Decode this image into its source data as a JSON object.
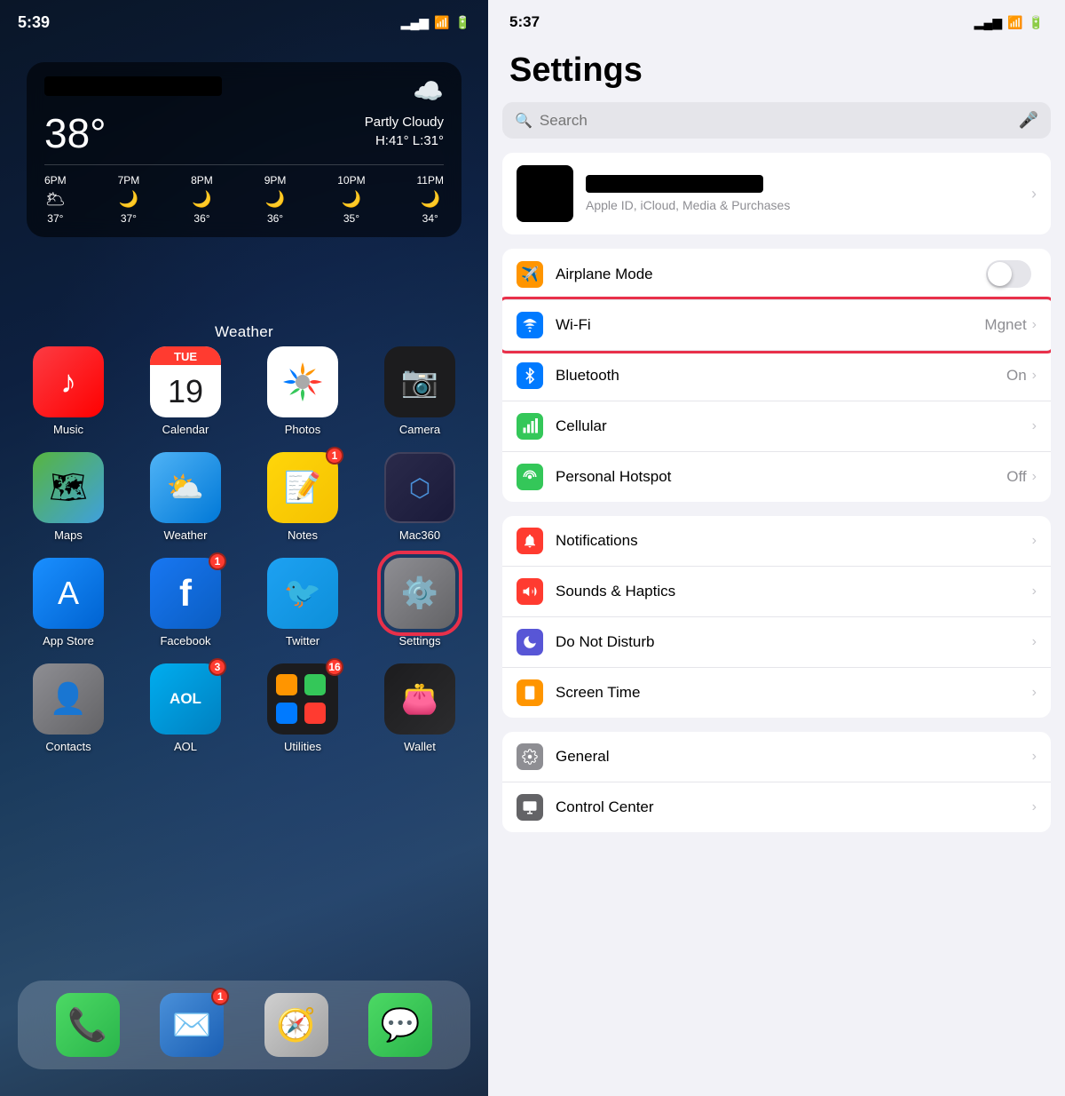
{
  "left": {
    "status_time": "5:39",
    "weather_widget": {
      "temp": "38°",
      "description": "Partly Cloudy\nH:41° L:31°",
      "cloud_emoji": "☁️",
      "hours": [
        {
          "time": "6PM",
          "icon": "🌥",
          "temp": "37°"
        },
        {
          "time": "7PM",
          "icon": "🌙",
          "temp": "37°"
        },
        {
          "time": "8PM",
          "icon": "🌙",
          "temp": "36°"
        },
        {
          "time": "9PM",
          "icon": "🌙",
          "temp": "36°"
        },
        {
          "time": "10PM",
          "icon": "🌙",
          "temp": "35°"
        },
        {
          "time": "11PM",
          "icon": "🌙",
          "temp": "34°"
        }
      ],
      "label": "Weather"
    },
    "apps_row1": [
      {
        "name": "Music",
        "label": "Music"
      },
      {
        "name": "Calendar",
        "label": "Calendar"
      },
      {
        "name": "Photos",
        "label": "Photos"
      },
      {
        "name": "Camera",
        "label": "Camera"
      }
    ],
    "apps_row2": [
      {
        "name": "Maps",
        "label": "Maps"
      },
      {
        "name": "Weather",
        "label": "Weather"
      },
      {
        "name": "Notes",
        "label": "Notes",
        "badge": "1"
      },
      {
        "name": "Mac360",
        "label": "Mac360"
      }
    ],
    "apps_row3": [
      {
        "name": "App Store",
        "label": "App Store"
      },
      {
        "name": "Facebook",
        "label": "Facebook",
        "badge": "1"
      },
      {
        "name": "Twitter",
        "label": "Twitter"
      },
      {
        "name": "Settings",
        "label": "Settings",
        "circled": true
      }
    ],
    "apps_row4": [
      {
        "name": "Contacts",
        "label": "Contacts"
      },
      {
        "name": "AOL",
        "label": "AOL",
        "badge": "3"
      },
      {
        "name": "Utilities",
        "label": "Utilities",
        "badge": "16"
      },
      {
        "name": "Wallet",
        "label": "Wallet"
      }
    ],
    "dock": [
      {
        "name": "Phone",
        "label": "Phone"
      },
      {
        "name": "Mail",
        "label": "Mail",
        "badge": "1"
      },
      {
        "name": "Safari",
        "label": "Safari"
      },
      {
        "name": "Messages",
        "label": "Messages"
      }
    ]
  },
  "right": {
    "status_time": "5:37",
    "title": "Settings",
    "search_placeholder": "Search",
    "profile": {
      "subtitle": "Apple ID, iCloud, Media & Purchases"
    },
    "group1": [
      {
        "icon": "✈️",
        "icon_style": "si-orange",
        "label": "Airplane Mode",
        "value": "",
        "toggle": true
      },
      {
        "icon": "📶",
        "icon_style": "si-blue",
        "label": "Wi-Fi",
        "value": "Mgnet",
        "chevron": true,
        "highlighted": true
      },
      {
        "icon": "🔵",
        "icon_style": "si-blue-dark",
        "label": "Bluetooth",
        "value": "On",
        "chevron": true
      },
      {
        "icon": "📡",
        "icon_style": "si-green",
        "label": "Cellular",
        "value": "",
        "chevron": true
      },
      {
        "icon": "🔗",
        "icon_style": "si-green",
        "label": "Personal Hotspot",
        "value": "Off",
        "chevron": true
      }
    ],
    "group2": [
      {
        "icon": "🔔",
        "icon_style": "si-red",
        "label": "Notifications",
        "value": "",
        "chevron": true
      },
      {
        "icon": "🔊",
        "icon_style": "si-red-sound",
        "label": "Sounds & Haptics",
        "value": "",
        "chevron": true
      },
      {
        "icon": "🌙",
        "icon_style": "si-purple",
        "label": "Do Not Disturb",
        "value": "",
        "chevron": true
      },
      {
        "icon": "⏱",
        "icon_style": "si-yellow",
        "label": "Screen Time",
        "value": "",
        "chevron": true
      }
    ],
    "group3": [
      {
        "icon": "⚙️",
        "icon_style": "si-gray",
        "label": "General",
        "value": "",
        "chevron": true
      },
      {
        "icon": "🎛",
        "icon_style": "si-gray2",
        "label": "Control Center",
        "value": "",
        "chevron": true
      }
    ]
  }
}
